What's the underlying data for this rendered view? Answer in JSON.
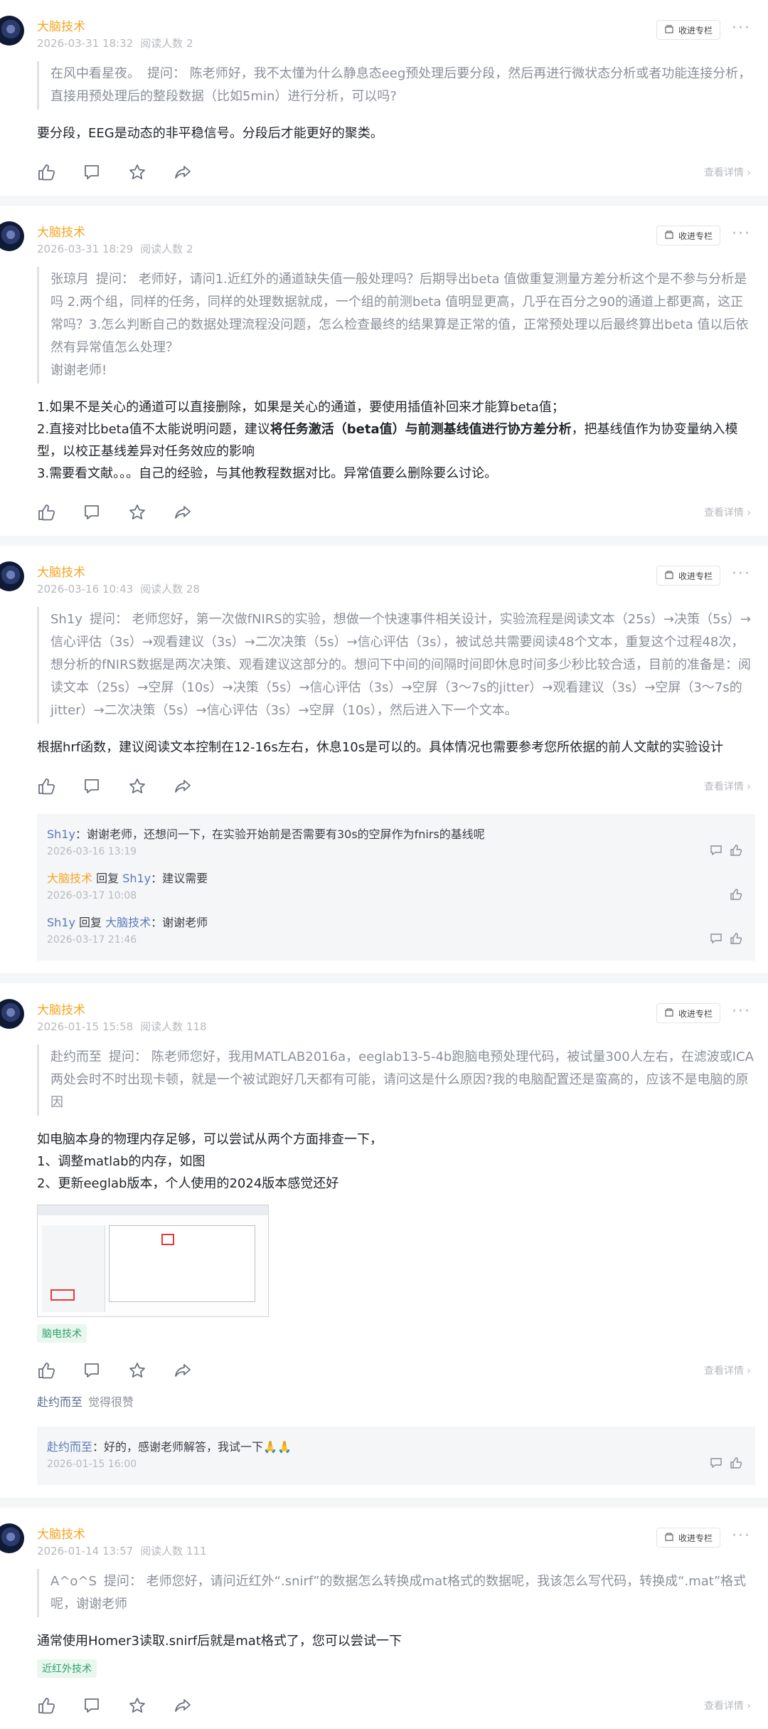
{
  "collect_label": "收进专栏",
  "more_label": "···",
  "detail_label": "查看详情 ›",
  "posts": [
    {
      "name": "大脑技术",
      "time": "2026-03-31 18:32",
      "readers": "阅读人数 2",
      "asker": "在风中看星夜。",
      "question": "提问： 陈老师好，我不太懂为什么静息态eeg预处理后要分段，然后再进行微状态分析或者功能连接分析，直接用预处理后的整段数据（比如5min）进行分析，可以吗?",
      "answer_lines": [
        "要分段，EEG是动态的非平稳信号。分段后才能更好的聚类。"
      ]
    },
    {
      "name": "大脑技术",
      "time": "2026-03-31 18:29",
      "readers": "阅读人数 2",
      "asker": "张琼月",
      "question": "提问： 老师好，请问1.近红外的通道缺失值一般处理吗？后期导出beta 值做重复测量方差分析这个是不参与分析是吗 2.两个组，同样的任务，同样的处理数据就成，一个组的前测beta 值明显更高，几乎在百分之90的通道上都更高，这正常吗？3.怎么判断自己的数据处理流程没问题，怎么检查最终的结果算是正常的值，正常预处理以后最终算出beta 值以后依然有异常值怎么处理？",
      "question_tail": "谢谢老师!",
      "answer_lines": [
        "1.如果不是关心的通道可以直接删除，如果是关心的通道，要使用插值补回来才能算beta值；",
        "2.直接对比beta值不太能说明问题，建议",
        "将任务激活（beta值）与前测基线值进行协方差分析",
        "，把基线值作为协变量纳入模型，以校正基线差异对任务效应的影响",
        "3.需要看文献。。。自己的经验，与其他教程数据对比。异常值要么删除要么讨论。"
      ]
    },
    {
      "name": "大脑技术",
      "time": "2026-03-16 10:43",
      "readers": "阅读人数 28",
      "asker": "Sh1y",
      "question": "提问： 老师您好，第一次做fNIRS的实验，想做一个快速事件相关设计，实验流程是阅读文本（25s）→决策（5s）→信心评估（3s）→观看建议（3s）→二次决策（5s）→信心评估（3s），被试总共需要阅读48个文本，重复这个过程48次，想分析的fNIRS数据是两次决策、观看建议这部分的。想问下中间的间隔时间即休息时间多少秒比较合适，目前的准备是：阅读文本（25s）→空屏（10s）→决策（5s）→信心评估（3s）→空屏（3～7s的jitter）→观看建议（3s）→空屏（3～7s的jitter）→二次决策（5s）→信心评估（3s）→空屏（10s），然后进入下一个文本。",
      "answer_lines": [
        "根据hrf函数，建议阅读文本控制在12-16s左右，休息10s是可以的。具体情况也需要参考您所依据的前人文献的实验设计"
      ],
      "replies": [
        {
          "from": "Sh1y",
          "to": "",
          "reply_word": "",
          "text": "：谢谢老师，还想问一下，在实验开始前是否需要有30s的空屏作为fnirs的基线呢",
          "time": "2026-03-16 13:19"
        },
        {
          "from": "大脑技术",
          "to": "Sh1y",
          "reply_word": " 回复 ",
          "text": "：建议需要",
          "time": "2026-03-17 10:08"
        },
        {
          "from": "Sh1y",
          "to": "大脑技术",
          "reply_word": " 回复 ",
          "text": "：谢谢老师",
          "time": "2026-03-17 21:46"
        }
      ]
    },
    {
      "name": "大脑技术",
      "time": "2026-01-15 15:58",
      "readers": "阅读人数 118",
      "asker": "赴约而至",
      "question": "提问： 陈老师您好，我用MATLAB2016a，eeglab13-5-4b跑脑电预处理代码，被试量300人左右，在滤波或ICA两处会时不时出现卡顿，就是一个被试跑好几天都有可能，请问这是什么原因?我的电脑配置还是蛮高的，应该不是电脑的原因",
      "answer_lines": [
        "如电脑本身的物理内存足够，可以尝试从两个方面排查一下，",
        "1、调整matlab的内存，如图",
        "2、更新eeglab版本，个人使用的2024版本感觉还好"
      ],
      "tag": "脑电技术",
      "liker": "赴约而至",
      "liker_text": "觉得很赞",
      "replies": [
        {
          "from": "赴约而至",
          "to": "",
          "reply_word": "",
          "text": "：好的，感谢老师解答，我试一下🙏🙏",
          "time": "2026-01-15 16:00"
        }
      ]
    },
    {
      "name": "大脑技术",
      "time": "2026-01-14 13:57",
      "readers": "阅读人数 111",
      "asker": "A^o^S",
      "question": "提问： 老师您好，请问近红外“.snirf”的数据怎么转换成mat格式的数据呢，我该怎么写代码，转换成“.mat”格式呢，谢谢老师",
      "answer_lines": [
        "通常使用Homer3读取.snirf后就是mat格式了，您可以尝试一下"
      ],
      "tag": "近红外技术"
    }
  ]
}
